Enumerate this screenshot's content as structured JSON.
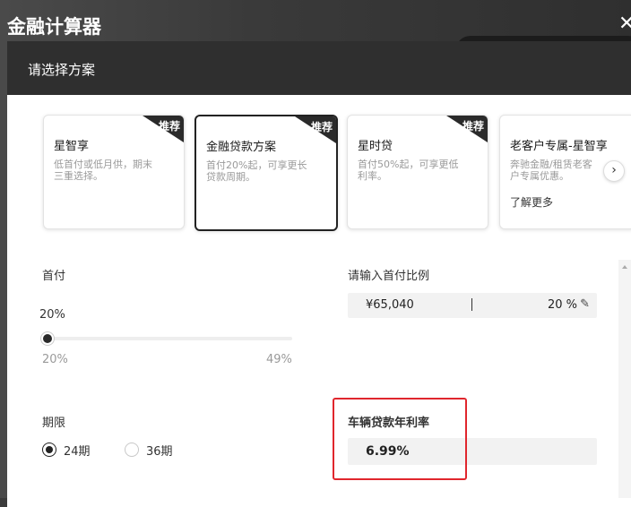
{
  "app": {
    "title": "金融计算器",
    "close_glyph": "✕"
  },
  "modal": {
    "title": "请选择方案"
  },
  "plans": [
    {
      "name": "星智享",
      "desc": "低首付或低月供，期末三重选择。",
      "badge": "推荐",
      "selected": false
    },
    {
      "name": "金融贷款方案",
      "desc": "首付20%起，可享更长贷款周期。",
      "badge": "推荐",
      "selected": true
    },
    {
      "name": "星时贷",
      "desc": "首付50%起，可享更低利率。",
      "badge": "推荐",
      "selected": false
    },
    {
      "name": "老客户专属-星智享",
      "desc": "奔驰金融/租赁老客户专属优惠。",
      "link": "了解更多",
      "selected": false
    }
  ],
  "next_glyph": "›",
  "down_payment": {
    "label": "首付",
    "current": "20%",
    "min": "20%",
    "max": "49%",
    "level_fraction": 0.0
  },
  "down_payment_input": {
    "label": "请输入首付比例",
    "amount": "¥65,040",
    "percent": "20 %",
    "edit_glyph": "✎"
  },
  "term": {
    "label": "期限",
    "options": [
      {
        "label": "24期",
        "checked": true
      },
      {
        "label": "36期",
        "checked": false
      }
    ]
  },
  "rate": {
    "label": "车辆贷款年利率",
    "value": "6.99%"
  },
  "colors": {
    "header": "#2f2f2f",
    "highlight": "#e0262d",
    "badge": "#2a2a2a"
  }
}
